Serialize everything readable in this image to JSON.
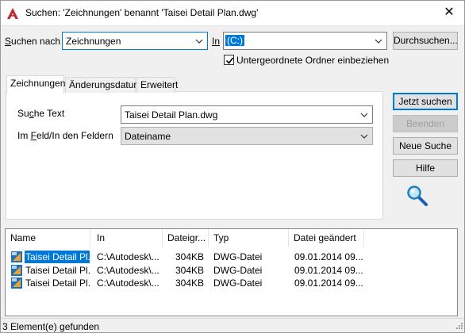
{
  "window": {
    "title": "Suchen: 'Zeichnungen' benannt 'Taisei Detail Plan.dwg'",
    "close_glyph": "✕"
  },
  "search_for": {
    "label": "Suchen nach",
    "value": "Zeichnungen"
  },
  "in": {
    "label": "In",
    "value": "(C:)"
  },
  "browse_button": "Durchsuchen...",
  "include_subfolders": {
    "label": "Untergeordnete Ordner einbeziehen",
    "checked": true
  },
  "tabs": [
    {
      "label": "Zeichnungen",
      "active": true
    },
    {
      "label": "Änderungsdatum",
      "active": false
    },
    {
      "label": "Erweitert",
      "active": false
    }
  ],
  "search_text": {
    "label": "Suche Text",
    "value": "Taisei Detail Plan.dwg"
  },
  "in_fields": {
    "label": "Im Feld/In den Feldern",
    "value": "Dateiname"
  },
  "buttons": {
    "search_now": "Jetzt suchen",
    "stop": "Beenden",
    "new_search": "Neue Suche",
    "help": "Hilfe"
  },
  "results": {
    "columns": [
      "Name",
      "In",
      "Dateigr...",
      "Typ",
      "Datei geändert"
    ],
    "rows": [
      {
        "name": "Taisei Detail Pl...",
        "in": "C:\\Autodesk\\...",
        "size": "304KB",
        "type": "DWG-Datei",
        "modified": "09.01.2014 09...",
        "selected": true
      },
      {
        "name": "Taisei Detail Pl...",
        "in": "C:\\Autodesk\\...",
        "size": "304KB",
        "type": "DWG-Datei",
        "modified": "09.01.2014 09...",
        "selected": false
      },
      {
        "name": "Taisei Detail Pl...",
        "in": "C:\\Autodesk\\...",
        "size": "304KB",
        "type": "DWG-Datei",
        "modified": "09.01.2014 09...",
        "selected": false
      }
    ]
  },
  "status": "3 Element(e) gefunden",
  "colors": {
    "accent": "#0078d7",
    "app_icon": "#c1272d"
  }
}
